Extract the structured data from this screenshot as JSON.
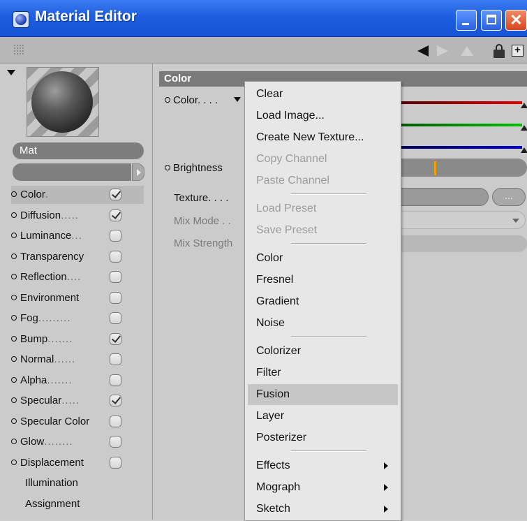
{
  "window": {
    "title": "Material Editor",
    "buttons": {
      "minimize": "Minimize",
      "maximize": "Maximize",
      "close": "✕"
    }
  },
  "toolbar": {
    "plus_label": "+"
  },
  "material": {
    "name": "Mat",
    "channels": [
      {
        "label": "Color",
        "dots": ".",
        "checked": true,
        "selected": true
      },
      {
        "label": "Diffusion",
        "dots": ".....",
        "checked": true
      },
      {
        "label": "Luminance",
        "dots": "...",
        "checked": false
      },
      {
        "label": "Transparency",
        "dots": "",
        "checked": false
      },
      {
        "label": "Reflection",
        "dots": "....",
        "checked": false
      },
      {
        "label": "Environment",
        "dots": "",
        "checked": false
      },
      {
        "label": "Fog",
        "dots": ".........",
        "checked": false
      },
      {
        "label": "Bump",
        "dots": ".......",
        "checked": true
      },
      {
        "label": "Normal",
        "dots": "......",
        "checked": false
      },
      {
        "label": "Alpha",
        "dots": ".......",
        "checked": false
      },
      {
        "label": "Specular",
        "dots": ".....",
        "checked": true
      },
      {
        "label": "Specular Color",
        "dots": "",
        "checked": false
      },
      {
        "label": "Glow",
        "dots": "........",
        "checked": false
      },
      {
        "label": "Displacement",
        "dots": "",
        "checked": false
      }
    ],
    "extra_items": [
      "Illumination",
      "Assignment"
    ]
  },
  "color_section": {
    "header": "Color",
    "color_label": "Color. . . .",
    "brightness_label": "Brightness",
    "texture_label": "Texture. . . .",
    "mix_mode_label": "Mix Mode . .",
    "mix_strength_label": "Mix Strength",
    "texture_button": "...",
    "brightness_level": 0.27
  },
  "context_menu": {
    "items": [
      {
        "label": "Clear",
        "enabled": true
      },
      {
        "label": "Load Image...",
        "enabled": true
      },
      {
        "label": "Create New Texture...",
        "enabled": true
      },
      {
        "label": "Copy Channel",
        "enabled": false
      },
      {
        "label": "Paste Channel",
        "enabled": false
      },
      {
        "separator": true
      },
      {
        "label": "Load Preset",
        "enabled": false
      },
      {
        "label": "Save Preset",
        "enabled": false
      },
      {
        "separator": true
      },
      {
        "label": "Color",
        "enabled": true
      },
      {
        "label": "Fresnel",
        "enabled": true
      },
      {
        "label": "Gradient",
        "enabled": true
      },
      {
        "label": "Noise",
        "enabled": true
      },
      {
        "separator": true
      },
      {
        "label": "Colorizer",
        "enabled": true
      },
      {
        "label": "Filter",
        "enabled": true
      },
      {
        "label": "Fusion",
        "enabled": true,
        "highlighted": true
      },
      {
        "label": "Layer",
        "enabled": true
      },
      {
        "label": "Posterizer",
        "enabled": true
      },
      {
        "separator": true
      },
      {
        "label": "Effects",
        "enabled": true,
        "submenu": true
      },
      {
        "label": "Mograph",
        "enabled": true,
        "submenu": true
      },
      {
        "label": "Sketch",
        "enabled": true,
        "submenu": true
      }
    ]
  }
}
